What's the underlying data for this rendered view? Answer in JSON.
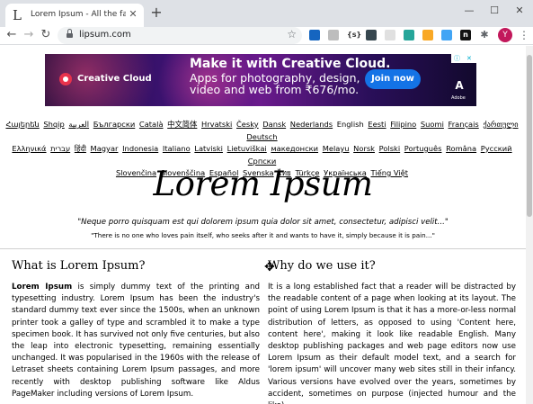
{
  "browser": {
    "tab": {
      "favicon": "L",
      "title": "Lorem Ipsum - All the facts - Lip"
    },
    "window_controls": [
      "minimize-icon",
      "maximize-icon",
      "close-icon"
    ],
    "address": {
      "url": "lipsum.com"
    },
    "extensions": [
      {
        "name": "ext-blue-square-icon",
        "color": "#1565c0",
        "label": ""
      },
      {
        "name": "ext-clock-icon",
        "color": "#bdbdbd",
        "label": ""
      },
      {
        "name": "ext-code-icon",
        "color": "#ffffff",
        "label": "{s}"
      },
      {
        "name": "ext-pen-icon",
        "color": "#37474f",
        "label": ""
      },
      {
        "name": "ext-grey-square-icon",
        "color": "#e0e0e0",
        "label": ""
      },
      {
        "name": "ext-green-circle-icon",
        "color": "#26a69a",
        "label": ""
      },
      {
        "name": "ext-yellow-icon",
        "color": "#f9a825",
        "label": ""
      },
      {
        "name": "ext-blue-icon",
        "color": "#42a5f5",
        "label": ""
      },
      {
        "name": "ext-n-icon",
        "color": "#111111",
        "label": "n"
      },
      {
        "name": "ext-puzzle-icon",
        "color": "#5f6368",
        "label": ""
      }
    ],
    "profile_initial": "Y"
  },
  "ad": {
    "brand": "Creative Cloud",
    "headline": "Make it with Creative Cloud.",
    "body": "Apps for photography, design, video and web from ₹676/mo.",
    "cta": "Join now",
    "adobe_logo": "A",
    "adobe_text": "Adobe"
  },
  "languages": {
    "line1": [
      "Հայերեն",
      "Shqip",
      "العربية",
      "Български",
      "Català",
      "中文简体",
      "Hrvatski",
      "Česky",
      "Dansk",
      "Nederlands",
      "English",
      "Eesti",
      "Filipino",
      "Suomi",
      "Français",
      "ქართული",
      "Deutsch"
    ],
    "line2": [
      "Ελληνικά",
      "עברית",
      "हिंदी",
      "Magyar",
      "Indonesia",
      "Italiano",
      "Latviski",
      "Lietuviškai",
      "македонски",
      "Melayu",
      "Norsk",
      "Polski",
      "Português",
      "Româna",
      "Pyccкий",
      "Српски"
    ],
    "line3": [
      "Slovenčina",
      "Slovenščina",
      "Español",
      "Svenska",
      "ไทย",
      "Türkçe",
      "Українська",
      "Tiếng Việt"
    ],
    "current": "English"
  },
  "hero": {
    "title": "Lorem Ipsum",
    "quote_latin": "\"Neque porro quisquam est qui dolorem ipsum quia dolor sit amet, consectetur, adipisci velit...\"",
    "quote_english": "\"There is no one who loves pain itself, who seeks after it and wants to have it, simply because it is pain...\""
  },
  "left": {
    "heading": "What is Lorem Ipsum?",
    "lead": "Lorem Ipsum",
    "body": " is simply dummy text of the printing and typesetting industry. Lorem Ipsum has been the industry's standard dummy text ever since the 1500s, when an unknown printer took a galley of type and scrambled it to make a type specimen book. It has survived not only five centuries, but also the leap into electronic typesetting, remaining essentially unchanged. It was popularised in the 1960s with the release of Letraset sheets containing Lorem Ipsum passages, and more recently with desktop publishing software like Aldus PageMaker including versions of Lorem Ipsum."
  },
  "right": {
    "heading": "Why do we use it?",
    "body": "It is a long established fact that a reader will be distracted by the readable content of a page when looking at its layout. The point of using Lorem Ipsum is that it has a more-or-less normal distribution of letters, as opposed to using 'Content here, content here', making it look like readable English. Many desktop publishing packages and web page editors now use Lorem Ipsum as their default model text, and a search for 'lorem ipsum' will uncover many web sites still in their infancy. Various versions have evolved over the years, sometimes by accident, sometimes on purpose (injected humour and the like)."
  }
}
